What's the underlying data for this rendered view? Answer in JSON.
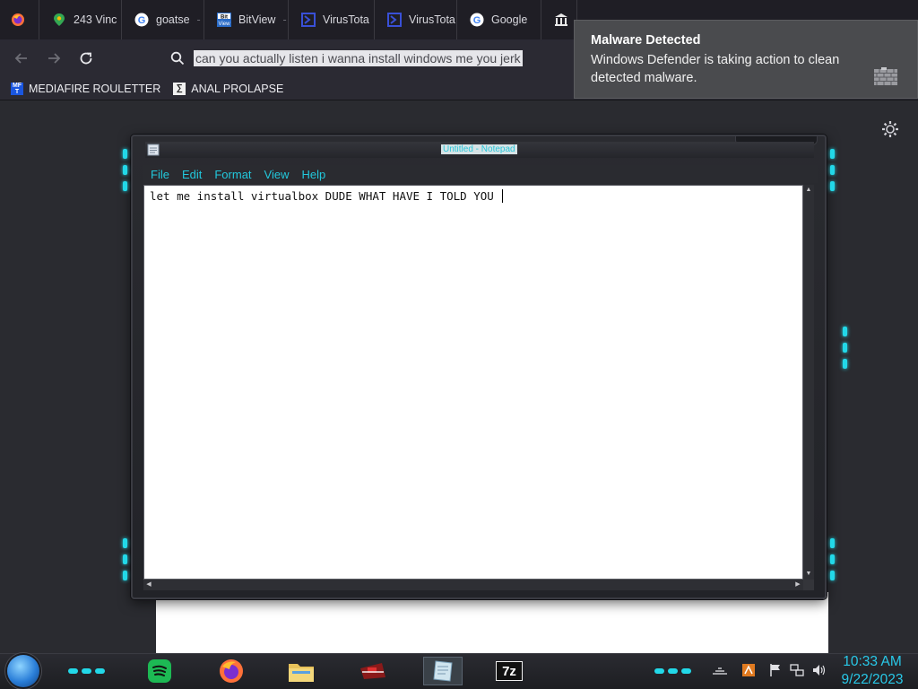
{
  "browser": {
    "tabs": [
      {
        "label": "",
        "icon": "firefox-icon"
      },
      {
        "label": "243 Vinc",
        "icon": "maps-pin-icon"
      },
      {
        "label": "goatse",
        "suffix": " - ·",
        "icon": "google-icon"
      },
      {
        "label": "BitView",
        "suffix": " -",
        "icon": "bitview-icon"
      },
      {
        "label": "VirusTota",
        "icon": "virustotal-icon"
      },
      {
        "label": "VirusTota",
        "icon": "virustotal-icon"
      },
      {
        "label": "Google",
        "icon": "google-icon"
      },
      {
        "label": "",
        "icon": "museum-icon"
      }
    ],
    "url_text": "can you actually listen i wanna install windows me you jerk",
    "bookmarks": [
      {
        "label": "MEDIAFIRE ROULETTER",
        "icon_text": "MF T"
      },
      {
        "label": "ANAL PROLAPSE",
        "icon_text": "∑"
      }
    ]
  },
  "toast": {
    "title": "Malware Detected",
    "body": "Windows Defender is taking action to clean detected malware."
  },
  "notepad": {
    "title": "Untitled - Notepad",
    "menu": [
      "File",
      "Edit",
      "Format",
      "View",
      "Help"
    ],
    "content": "let me install virtualbox DUDE WHAT HAVE I TOLD YOU "
  },
  "taskbar": {
    "apps": [
      "spotify-icon",
      "firefox-icon",
      "file-explorer-icon",
      "app-icon",
      "notepad-icon",
      "7zip-icon"
    ],
    "sevenzip_label": "7z",
    "time": "10:33 AM",
    "date": "9/22/2023"
  },
  "colors": {
    "accent": "#22c8dc",
    "toast_bg": "#4a4b4e",
    "chrome_bg": "#2b2a33"
  }
}
